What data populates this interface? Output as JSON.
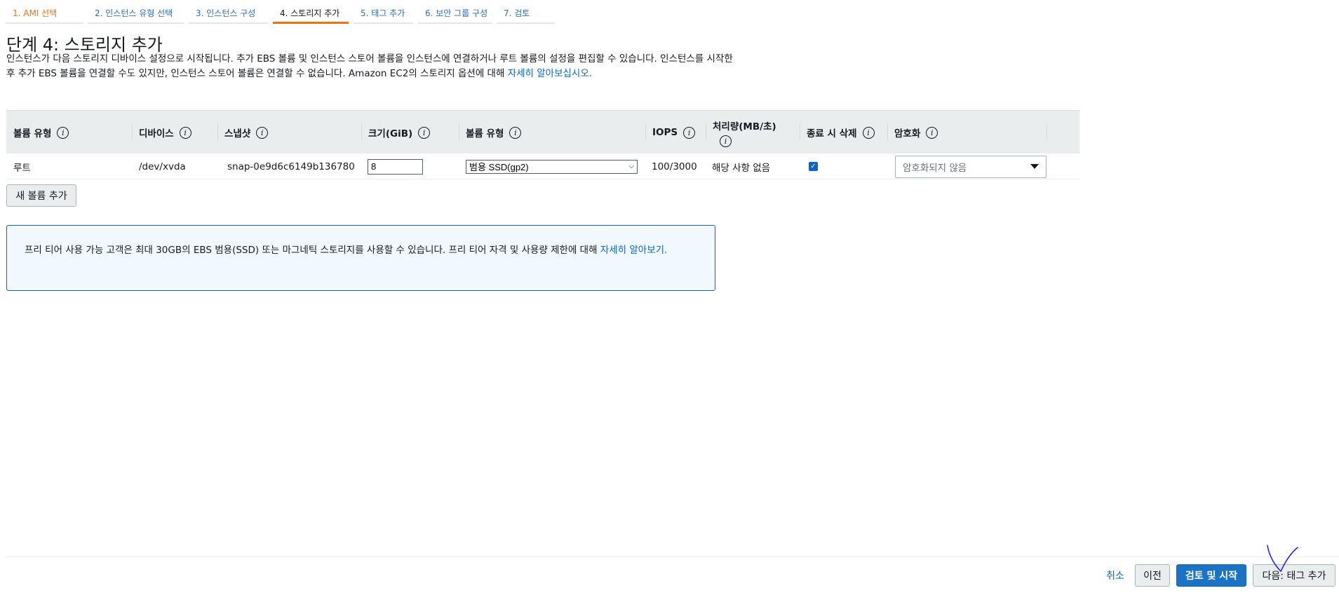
{
  "wizard": {
    "steps": [
      {
        "label": "1. AMI 선택",
        "state": "done"
      },
      {
        "label": "2. 인스턴스 유형 선택",
        "state": "todo"
      },
      {
        "label": "3. 인스턴스 구성",
        "state": "todo"
      },
      {
        "label": "4. 스토리지 추가",
        "state": "active"
      },
      {
        "label": "5. 태그 추가",
        "state": "todo"
      },
      {
        "label": "6. 보안 그룹 구성",
        "state": "todo"
      },
      {
        "label": "7. 검토",
        "state": "todo"
      }
    ]
  },
  "page": {
    "title": "단계 4: 스토리지 추가",
    "description": "인스턴스가 다음 스토리지 디바이스 설정으로 시작됩니다. 추가 EBS 볼륨 및 인스턴스 스토어 볼륨을 인스턴스에 연결하거나 루트 볼륨의 설정을 편집할 수 있습니다. 인스턴스를 시작한 후 추가 EBS 볼륨을 연결할 수도 있지만, 인스턴스 스토어 볼륨은 연결할 수 없습니다. Amazon EC2의 스토리지 옵션에 대해 ",
    "description_link": "자세히 알아보십시오."
  },
  "table": {
    "columns": [
      {
        "label": "볼륨 유형"
      },
      {
        "label": "디바이스"
      },
      {
        "label": "스냅샷"
      },
      {
        "label": "크기(GiB)"
      },
      {
        "label": "볼륨 유형"
      },
      {
        "label": "IOPS"
      },
      {
        "label": "처리량(MB/초)"
      },
      {
        "label": "종료 시 삭제"
      },
      {
        "label": "암호화"
      }
    ],
    "info_glyph": "i",
    "rows": [
      {
        "volume_type": "루트",
        "device": "/dev/xvda",
        "snapshot": "snap-0e9d6c6149b136780",
        "size": "8",
        "ebs_type": "범용 SSD(gp2)",
        "iops": "100/3000",
        "throughput": "해당 사항 없음",
        "delete_on_termination": true,
        "encryption": "암호화되지 않음"
      }
    ]
  },
  "buttons": {
    "add_volume": "새 볼륨 추가",
    "cancel": "취소",
    "previous": "이전",
    "review_launch": "검토 및 시작",
    "next": "다음: 태그 추가"
  },
  "notice": {
    "text": "프리 티어 사용 가능 고객은 최대 30GB의 EBS 범용(SSD) 또는 마그네틱 스토리지를 사용할 수 있습니다. 프리 티어 자격 및 사용량 제한에 대해 ",
    "link": "자세히 알아보기."
  },
  "colors": {
    "accent_orange": "#ec7211",
    "link_blue": "#0a66c2",
    "primary_button": "#1a73c4",
    "notice_bg": "#f1f8ff"
  }
}
